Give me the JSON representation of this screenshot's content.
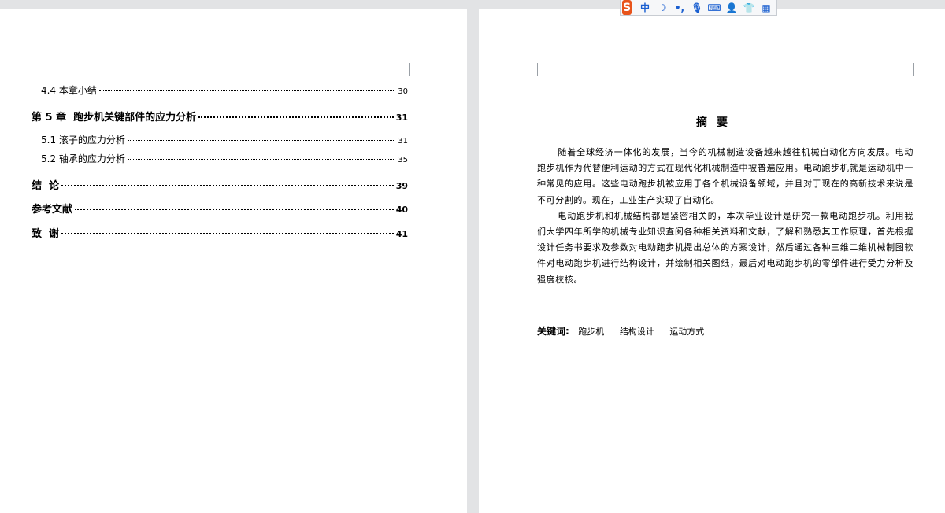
{
  "toc": [
    {
      "title": "4.4 本章小结",
      "page": "30",
      "level": "sub"
    },
    {
      "title": "第 5 章  跑步机关键部件的应力分析",
      "page": "31",
      "level": "chapter"
    },
    {
      "title": "5.1 滚子的应力分析",
      "page": "31",
      "level": "sub"
    },
    {
      "title": "5.2 轴承的应力分析",
      "page": "35",
      "level": "sub"
    },
    {
      "title": "结  论",
      "page": "39",
      "level": "chapter"
    },
    {
      "title": "参考文献",
      "page": "40",
      "level": "chapter"
    },
    {
      "title": "致  谢",
      "page": "41",
      "level": "chapter"
    }
  ],
  "abstract": {
    "title": "摘要",
    "paragraphs": [
      "随着全球经济一体化的发展，当今的机械制造设备越来越往机械自动化方向发展。电动跑步机作为代替便利运动的方式在现代化机械制造中被普遍应用。电动跑步机就是运动机中一种常见的应用。这些电动跑步机被应用于各个机械设备领域，并且对于现在的高新技术来说是不可分割的。现在，工业生产实现了自动化。",
      "电动跑步机和机械结构都是紧密相关的，本次毕业设计是研究一款电动跑步机。利用我们大学四年所学的机械专业知识查阅各种相关资料和文献，了解和熟悉其工作原理，首先根据设计任务书要求及参数对电动跑步机提出总体的方案设计，然后通过各种三维二维机械制图软件对电动跑步机进行结构设计，并绘制相关图纸，最后对电动跑步机的零部件进行受力分析及强度校核。"
    ],
    "keywords_label": "关键词:",
    "keywords": [
      "跑步机",
      "结构设计",
      "运动方式"
    ]
  },
  "ime_toolbar": {
    "logo": "S",
    "items": [
      {
        "name": "chinese-mode-icon",
        "glyph": "中"
      },
      {
        "name": "moon-icon",
        "glyph": "☽"
      },
      {
        "name": "punctuation-icon",
        "glyph": "•,"
      },
      {
        "name": "microphone-icon",
        "glyph": "🎙"
      },
      {
        "name": "keyboard-icon",
        "glyph": "⌨"
      },
      {
        "name": "user-icon",
        "glyph": "👤"
      },
      {
        "name": "skin-icon",
        "glyph": "👕"
      },
      {
        "name": "grid-menu-icon",
        "glyph": "▦"
      }
    ]
  }
}
